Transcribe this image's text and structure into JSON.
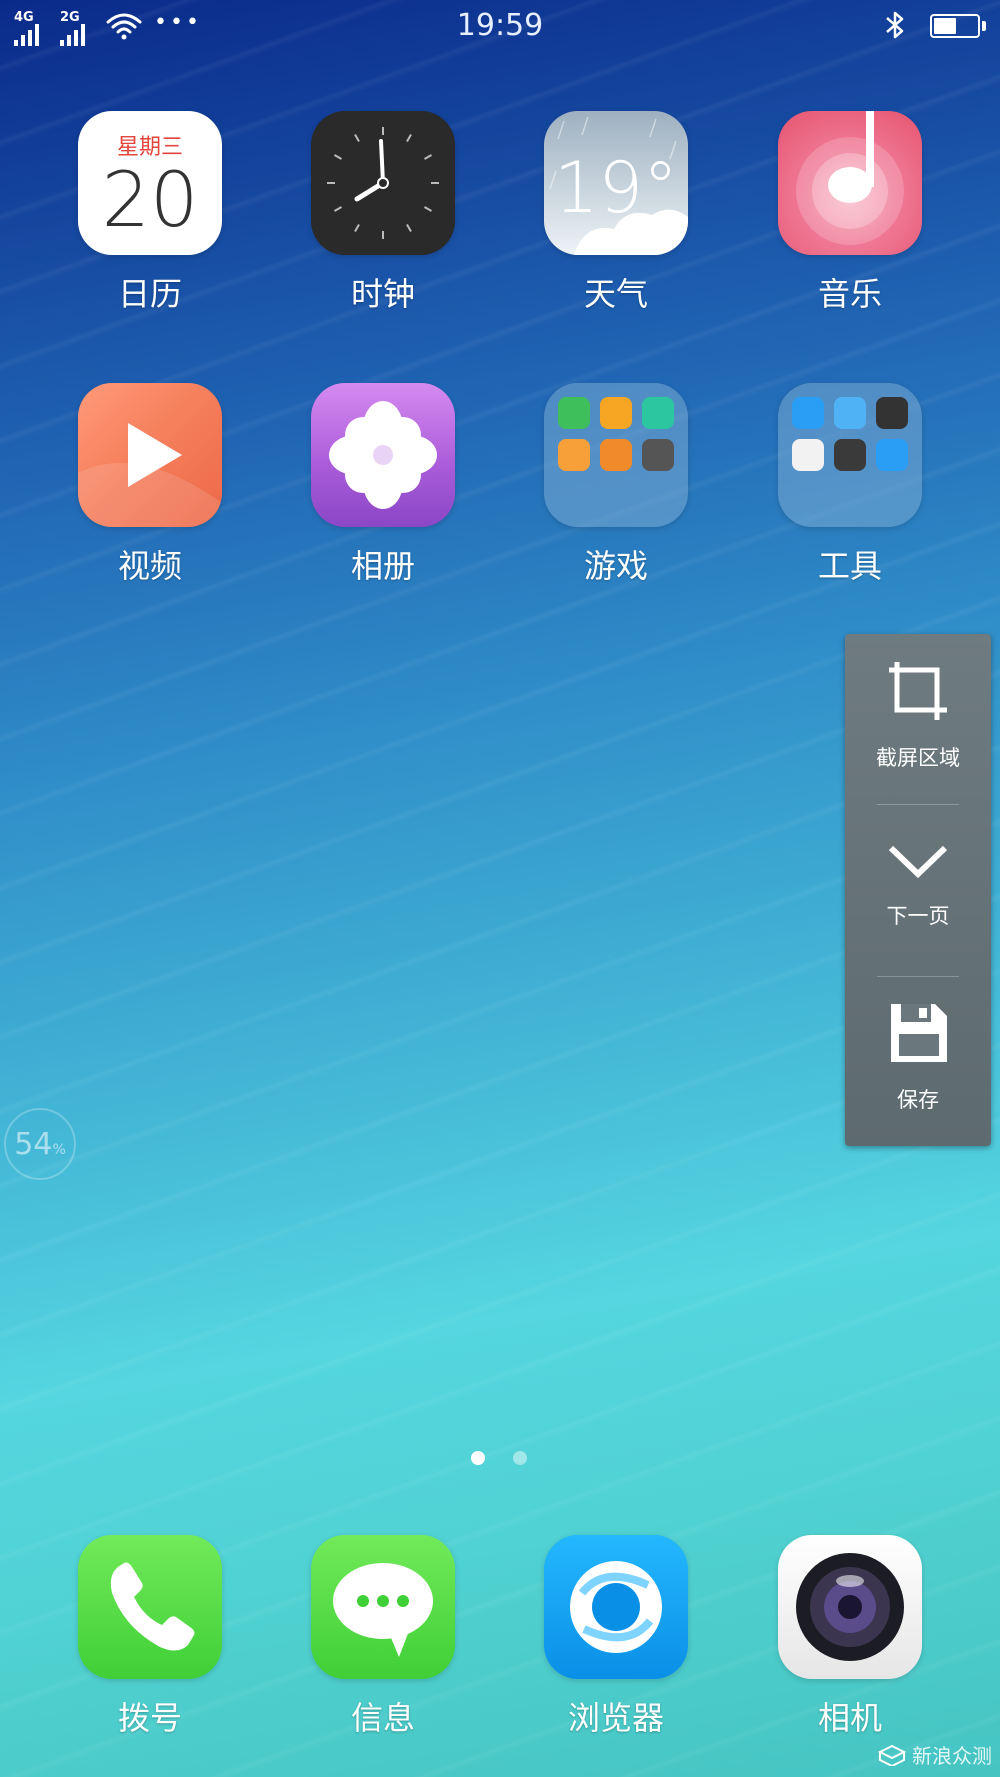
{
  "status_bar": {
    "network_1": "4G",
    "network_2": "2G",
    "more": "•••",
    "time": "19:59",
    "battery_level": 0.55
  },
  "apps_row1": [
    {
      "label": "日历",
      "weekday": "星期三",
      "day": "20",
      "icon": "calendar-icon"
    },
    {
      "label": "时钟",
      "icon": "clock-icon"
    },
    {
      "label": "天气",
      "temp": "19°",
      "icon": "weather-icon"
    },
    {
      "label": "音乐",
      "icon": "music-icon"
    }
  ],
  "apps_row2": [
    {
      "label": "视频",
      "icon": "video-icon"
    },
    {
      "label": "相册",
      "icon": "photos-icon"
    },
    {
      "label": "游戏",
      "icon": "folder-icon"
    },
    {
      "label": "工具",
      "icon": "folder-icon"
    }
  ],
  "dock": [
    {
      "label": "拨号",
      "icon": "phone-icon"
    },
    {
      "label": "信息",
      "icon": "message-icon"
    },
    {
      "label": "浏览器",
      "icon": "browser-icon"
    },
    {
      "label": "相机",
      "icon": "camera-icon"
    }
  ],
  "screenshot_panel": {
    "crop_label": "截屏区域",
    "next_label": "下一页",
    "save_label": "保存"
  },
  "memory_bubble": {
    "value": "54",
    "unit": "%"
  },
  "pages": {
    "count": 2,
    "current": 1
  },
  "watermark": "新浪众测",
  "colors": {
    "calendar_weekday": "#e2453c",
    "dock_green": "#3fcf36",
    "browser_blue": "#0a8fe6"
  }
}
